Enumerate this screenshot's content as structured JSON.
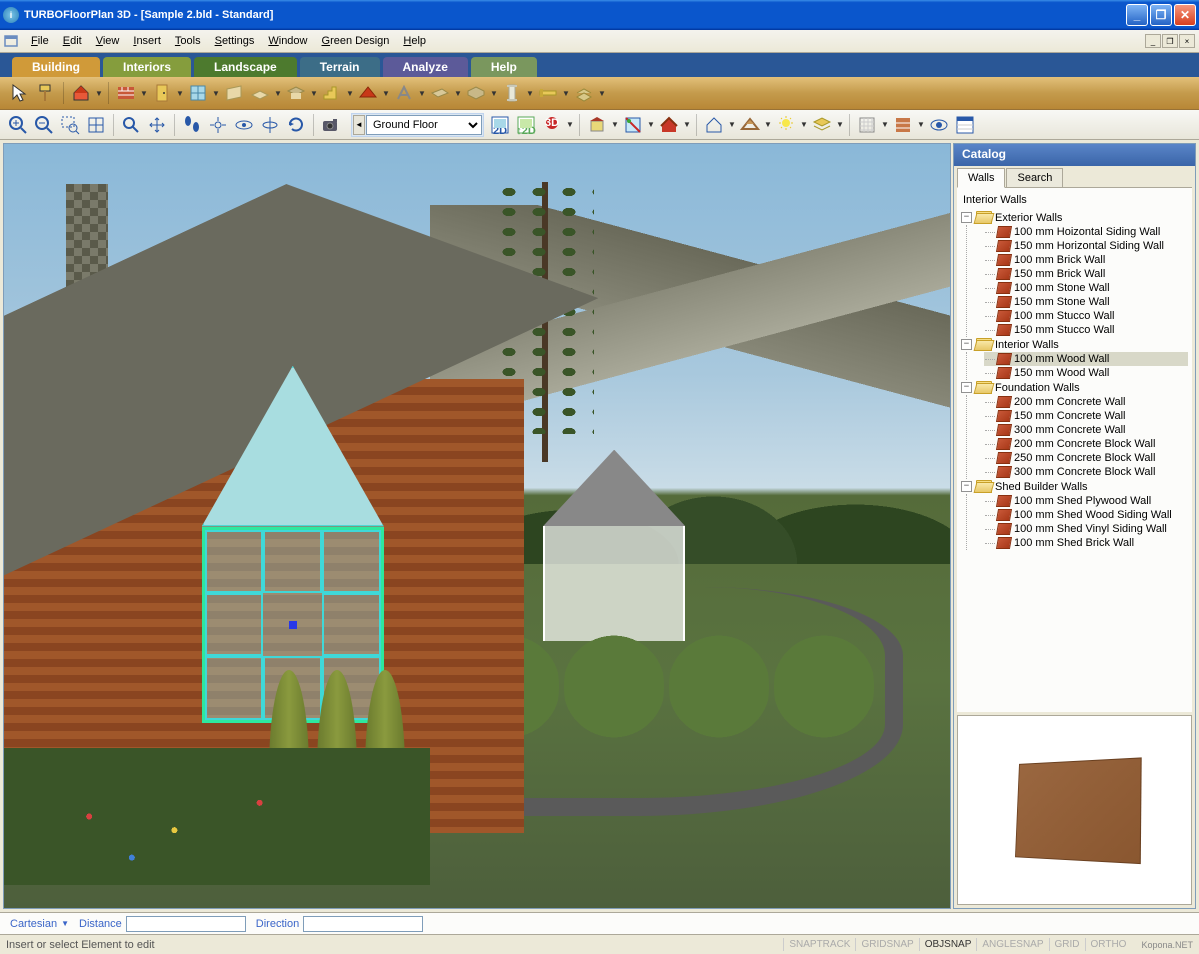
{
  "window": {
    "title": "TURBOFloorPlan 3D - [Sample 2.bld - Standard]"
  },
  "menu": {
    "file": "File",
    "edit": "Edit",
    "view": "View",
    "insert": "Insert",
    "tools": "Tools",
    "settings": "Settings",
    "window": "Window",
    "green": "Green Design",
    "help": "Help"
  },
  "tabs": {
    "building": "Building",
    "interiors": "Interiors",
    "landscape": "Landscape",
    "terrain": "Terrain",
    "analyze": "Analyze",
    "help": "Help"
  },
  "floor_selector": {
    "value": "Ground Floor"
  },
  "catalog": {
    "title": "Catalog",
    "tab_walls": "Walls",
    "tab_search": "Search",
    "root": "Interior Walls",
    "groups": [
      {
        "name": "Exterior Walls",
        "items": [
          "100 mm Hoizontal Siding Wall",
          "150 mm Horizontal Siding Wall",
          "100 mm Brick Wall",
          "150 mm Brick Wall",
          "100 mm Stone Wall",
          "150 mm Stone Wall",
          "100 mm Stucco Wall",
          "150 mm Stucco Wall"
        ]
      },
      {
        "name": "Interior Walls",
        "items": [
          "100 mm Wood Wall",
          "150 mm Wood Wall"
        ],
        "selected_index": 0
      },
      {
        "name": "Foundation Walls",
        "items": [
          "200 mm Concrete Wall",
          "150 mm Concrete Wall",
          "300 mm Concrete Wall",
          "200 mm Concrete Block Wall",
          "250 mm Concrete Block Wall",
          "300 mm Concrete Block Wall"
        ]
      },
      {
        "name": "Shed Builder Walls",
        "items": [
          "100 mm Shed Plywood Wall",
          "100 mm Shed Wood Siding Wall",
          "100 mm Shed Vinyl Siding Wall",
          "100 mm Shed Brick Wall"
        ]
      }
    ]
  },
  "status_input": {
    "mode": "Cartesian",
    "distance_label": "Distance",
    "direction_label": "Direction"
  },
  "status_bottom": {
    "hint": "Insert or select Element to edit",
    "toggles": [
      {
        "label": "SNAPTRACK",
        "on": false
      },
      {
        "label": "GRIDSNAP",
        "on": false
      },
      {
        "label": "OBJSNAP",
        "on": true
      },
      {
        "label": "ANGLESNAP",
        "on": false
      },
      {
        "label": "GRID",
        "on": false
      },
      {
        "label": "ORTHO",
        "on": false
      }
    ],
    "watermark": "Kopona.NET"
  }
}
